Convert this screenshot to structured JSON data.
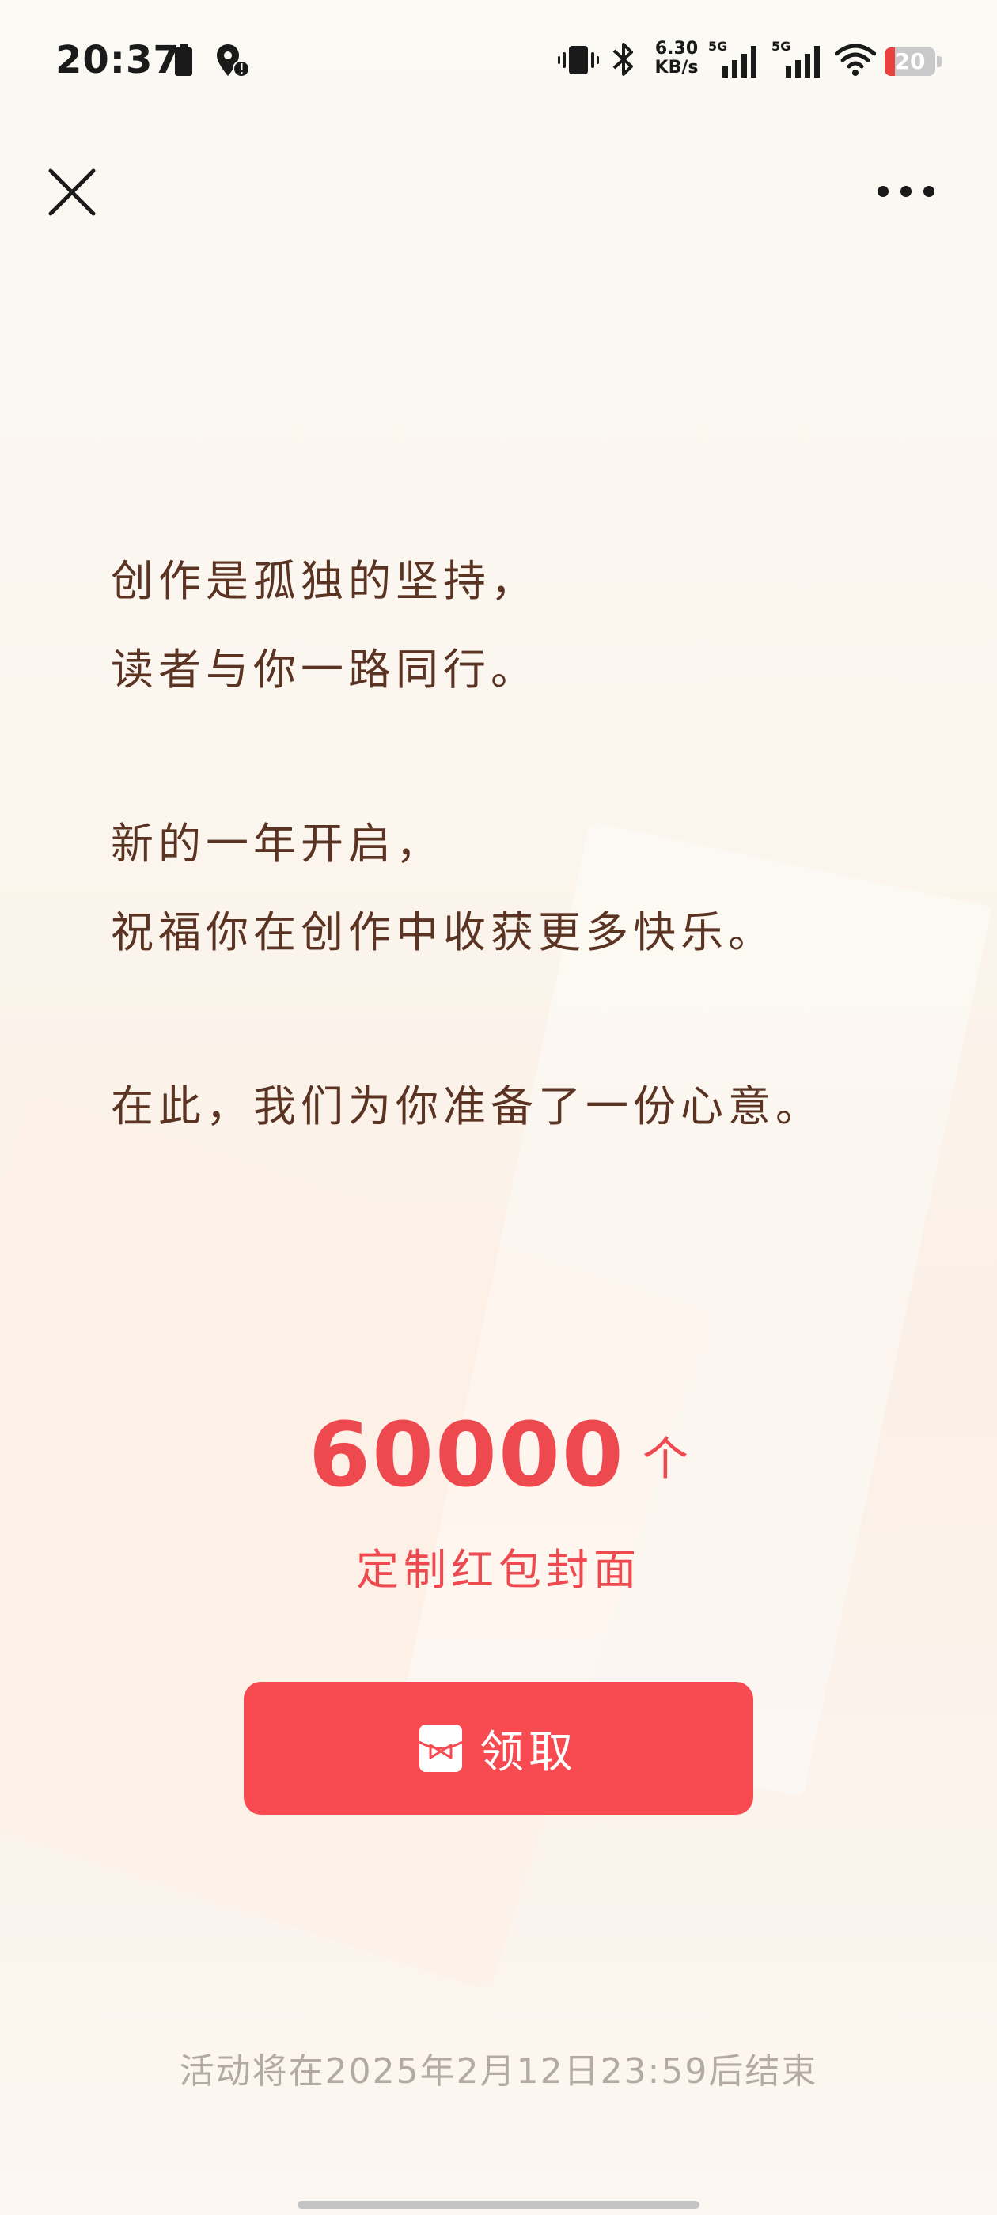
{
  "status_bar": {
    "time": "20:37",
    "net_speed_value": "6.30",
    "net_speed_unit": "KB/s",
    "signal1_label": "5G",
    "signal2_label": "5G",
    "battery_level": "20",
    "battery_fraction": 0.2,
    "battery_color": "#e94040"
  },
  "nav": {
    "close_icon": "close-icon",
    "more_icon": "more-dots-icon"
  },
  "message": {
    "line1": "创作是孤独的坚持，",
    "line2": "读者与你一路同行。",
    "line3": "新的一年开启，",
    "line4": "祝福你在创作中收获更多快乐。",
    "line5": "在此，我们为你准备了一份心意。"
  },
  "reward": {
    "count": "60000",
    "unit": "个",
    "label": "定制红包封面"
  },
  "claim_button": {
    "icon": "red-envelope-icon",
    "label": "领取",
    "color": "#f84a51"
  },
  "footer": {
    "note": "活动将在2025年2月12日23:59后结束"
  },
  "colors": {
    "text_brown": "#5a3322",
    "accent_red": "#ef4950",
    "muted": "#b4aaa4"
  }
}
